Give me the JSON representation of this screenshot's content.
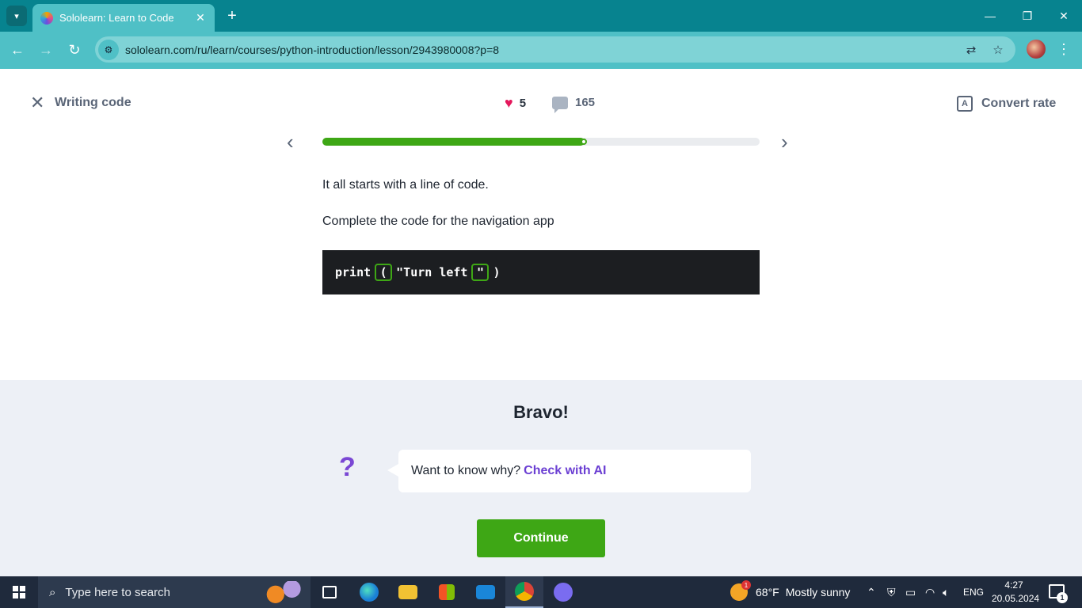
{
  "browser": {
    "tab_title": "Sololearn: Learn to Code",
    "url": "sololearn.com/ru/learn/courses/python-introduction/lesson/2943980008?p=8"
  },
  "lesson": {
    "title": "Writing code",
    "likes": "5",
    "comments": "165",
    "convert_label": "Convert rate",
    "progress_fraction": 0.6,
    "para1": "It all starts with a line of code.",
    "para2": "Complete the code for the navigation app",
    "code": {
      "keyword": "print",
      "slot1": "(",
      "string": "\"Turn left",
      "slot2": "\"",
      "closing": ")"
    }
  },
  "feedback": {
    "heading": "Bravo!",
    "prompt": "Want to know why?",
    "ai_link": "Check with AI",
    "continue_label": "Continue"
  },
  "taskbar": {
    "search_placeholder": "Type here to search",
    "weather_temp": "68°F",
    "weather_text": "Mostly sunny",
    "weather_badge": "1",
    "language": "ENG",
    "time": "4:27",
    "date": "20.05.2024",
    "notification_count": "1"
  },
  "colors": {
    "accent_green": "#3ea715",
    "ai_purple": "#6b3fd3",
    "heart_red": "#e4185c",
    "chrome_teal": "#4fc0c6"
  }
}
